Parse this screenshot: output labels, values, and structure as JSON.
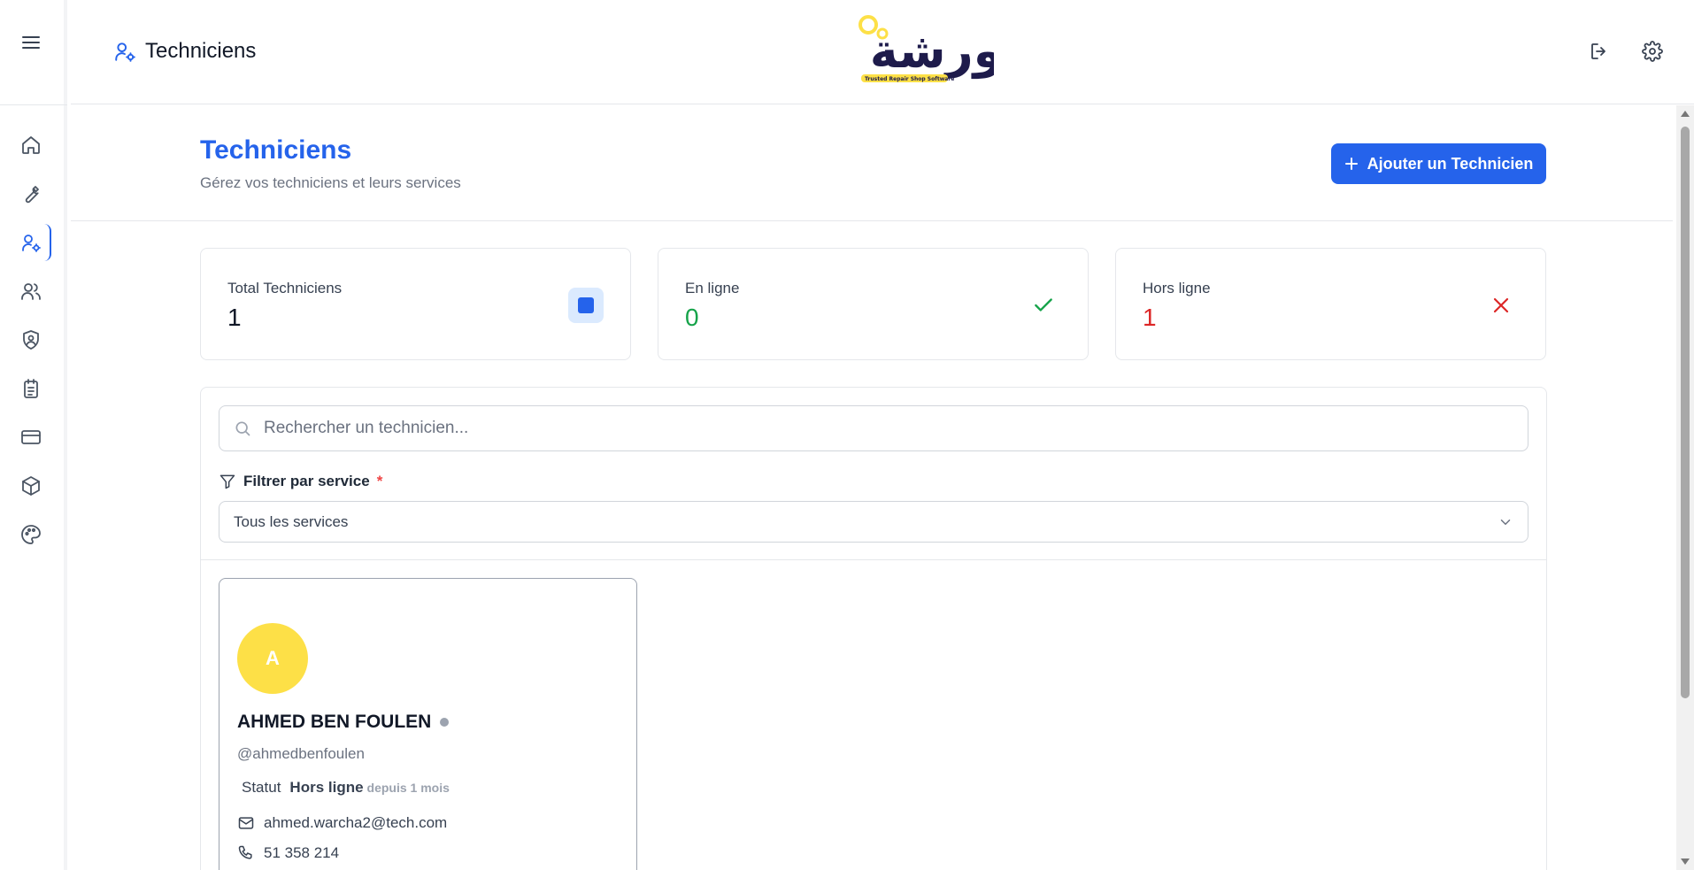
{
  "header": {
    "title": "Techniciens",
    "logo_text": "ورشة",
    "logo_tagline": "Trusted Repair Shop Software"
  },
  "sidebar": {
    "items": [
      {
        "icon": "home-icon"
      },
      {
        "icon": "wrench-icon"
      },
      {
        "icon": "user-cog-icon",
        "active": true
      },
      {
        "icon": "users-icon"
      },
      {
        "icon": "shield-user-icon"
      },
      {
        "icon": "clipboard-icon"
      },
      {
        "icon": "credit-card-icon"
      },
      {
        "icon": "package-icon"
      },
      {
        "icon": "palette-icon"
      }
    ]
  },
  "page": {
    "title": "Techniciens",
    "subtitle": "Gérez vos techniciens et leurs services",
    "add_button": "Ajouter un Technicien"
  },
  "stats": [
    {
      "label": "Total Techniciens",
      "value": "1",
      "color": "#111827"
    },
    {
      "label": "En ligne",
      "value": "0",
      "color": "#16a34a"
    },
    {
      "label": "Hors ligne",
      "value": "1",
      "color": "#dc2626"
    }
  ],
  "search": {
    "placeholder": "Rechercher un technicien..."
  },
  "filter": {
    "label": "Filtrer par service",
    "required_mark": "*",
    "selected": "Tous les services"
  },
  "technicians": [
    {
      "initial": "A",
      "name": "AHMED BEN FOULEN",
      "handle": "@ahmedbenfoulen",
      "statut_label": "Statut",
      "status": "Hors ligne",
      "since": "depuis 1 mois",
      "email": "ahmed.warcha2@tech.com",
      "phone": "51 358 214"
    }
  ],
  "colors": {
    "accent": "#2563eb",
    "online": "#16a34a",
    "offline": "#dc2626",
    "avatar": "#fde047"
  }
}
